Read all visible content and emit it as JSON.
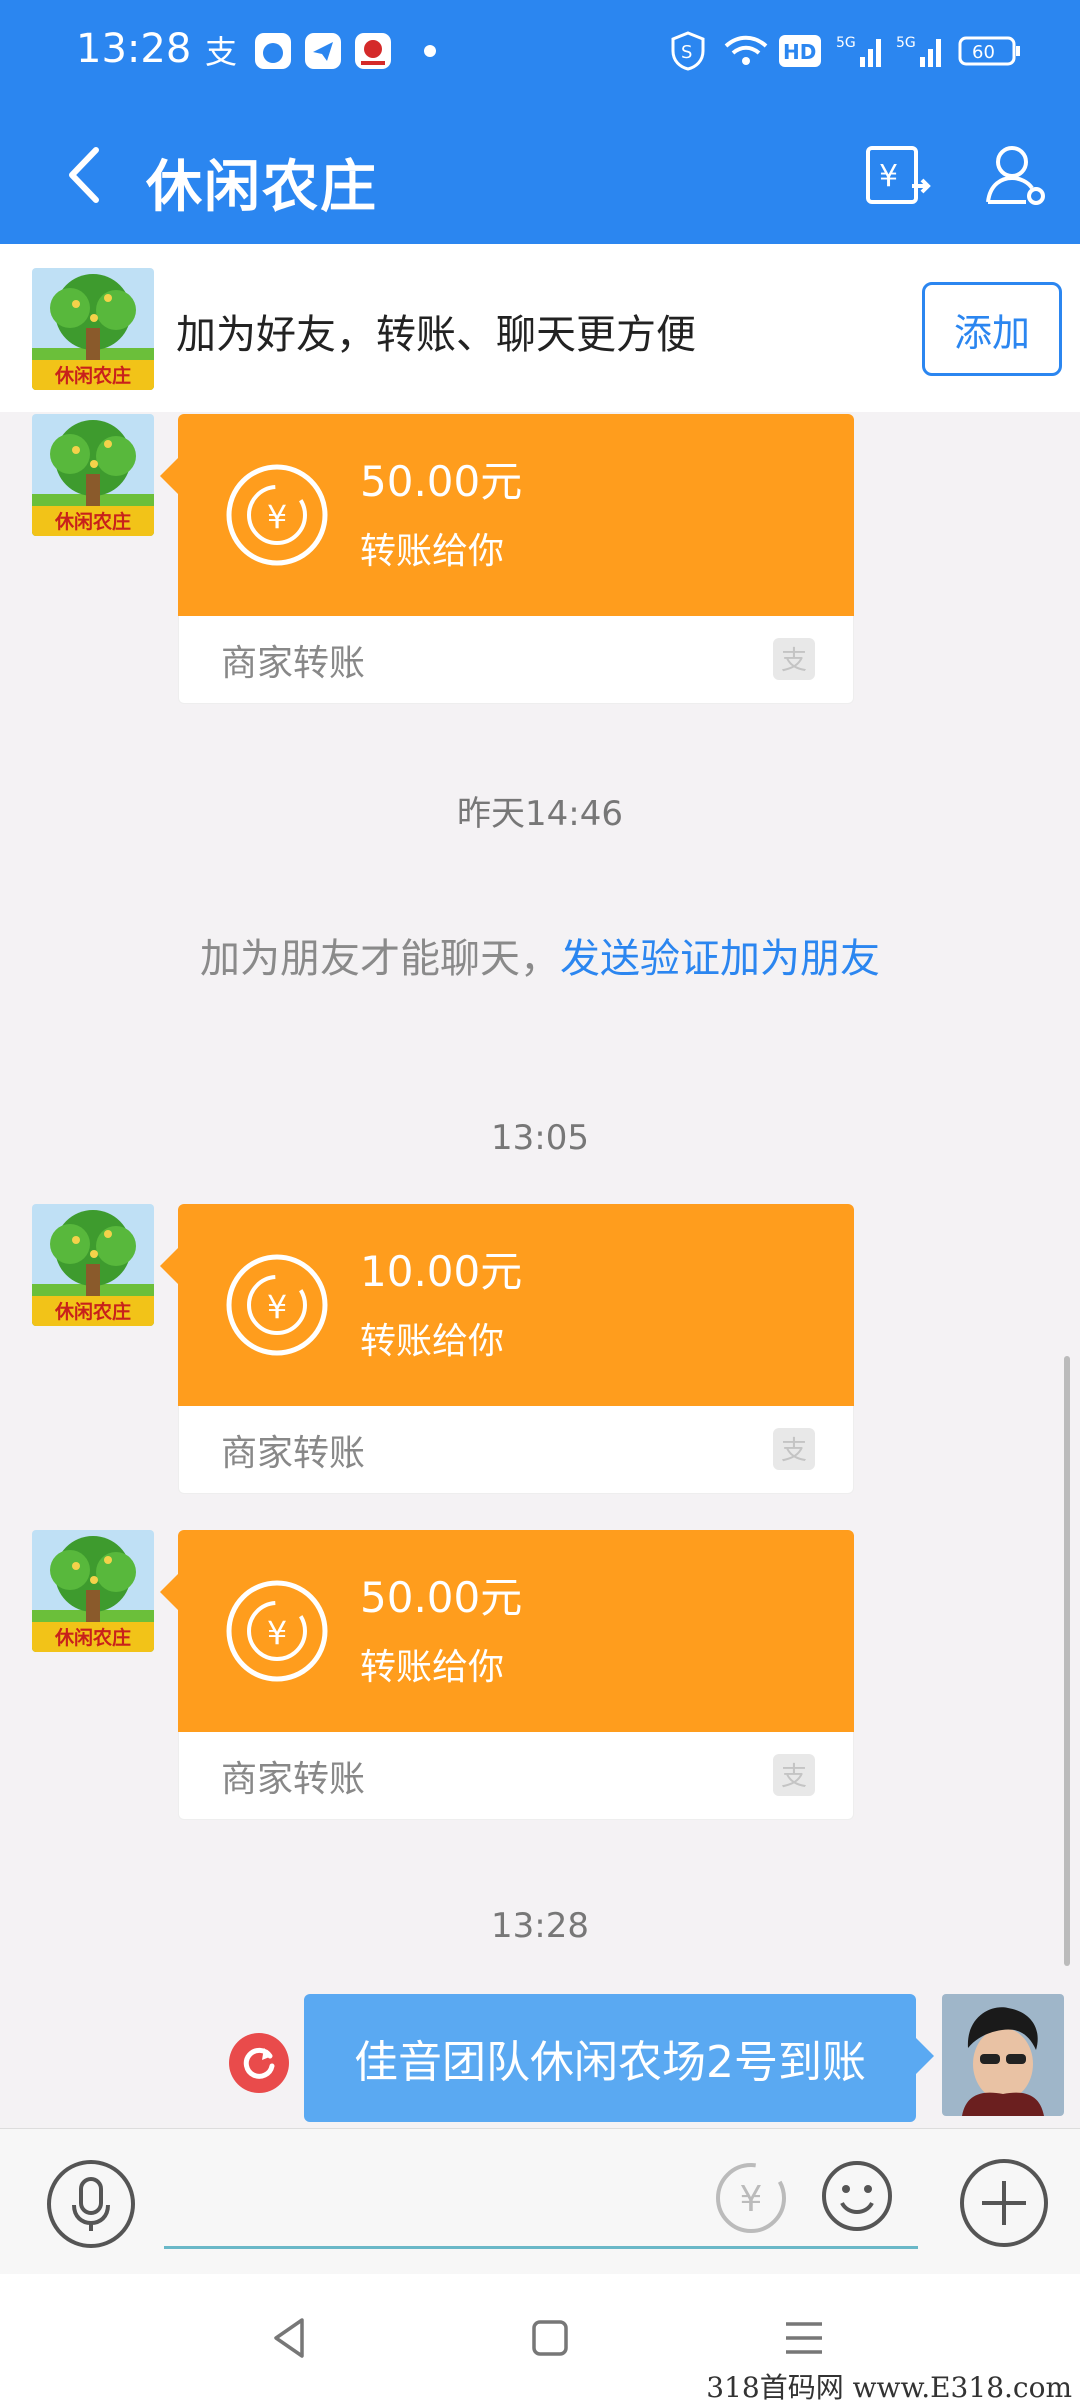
{
  "status_bar": {
    "time": "13:28",
    "battery": "60",
    "hd_label": "HD",
    "network_1": "5G",
    "network_2": "5G"
  },
  "header": {
    "title": "休闲农庄"
  },
  "add_banner": {
    "text": "加为好友，转账、聊天更方便",
    "button_label": "添加",
    "avatar_label": "休闲农庄"
  },
  "messages": {
    "card1": {
      "amount": "50.00元",
      "sub": "转账给你",
      "merchant": "商家转账",
      "avatar_label": "休闲农庄"
    },
    "ts1": "昨天14:46",
    "notice_text": "加为朋友才能聊天，",
    "notice_link": "发送验证加为朋友",
    "ts2": "13:05",
    "card2": {
      "amount": "10.00元",
      "sub": "转账给你",
      "merchant": "商家转账",
      "avatar_label": "休闲农庄"
    },
    "card3": {
      "amount": "50.00元",
      "sub": "转账给你",
      "merchant": "商家转账",
      "avatar_label": "休闲农庄"
    },
    "ts3": "13:28",
    "my_message": "佳音团队休闲农场2号到账"
  },
  "input": {
    "placeholder": ""
  },
  "watermark": "318首码网 www.E318.com",
  "colors": {
    "primary_blue": "#2b86f0",
    "transfer_orange": "#ff9d1d",
    "my_bubble": "#5aa9f2",
    "retry_red": "#e94b4b"
  }
}
